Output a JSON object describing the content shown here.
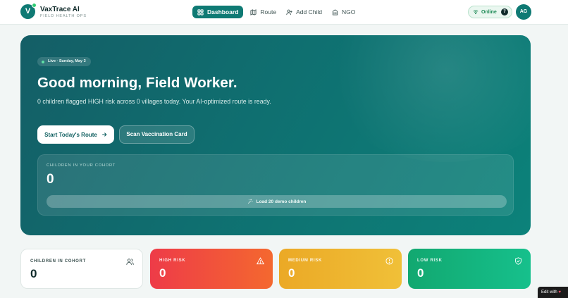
{
  "brand": {
    "logo_letter": "V",
    "name": "VaxTrace AI",
    "subtitle": "FIELD HEALTH OPS"
  },
  "nav": {
    "items": [
      {
        "label": "Dashboard",
        "icon": "grid-icon",
        "active": true
      },
      {
        "label": "Route",
        "icon": "map-icon",
        "active": false
      },
      {
        "label": "Add Child",
        "icon": "user-plus-icon",
        "active": false
      },
      {
        "label": "NGO",
        "icon": "building-icon",
        "active": false
      }
    ]
  },
  "status": {
    "online_label": "Online",
    "online_count": "7",
    "icon": "wifi-icon"
  },
  "user": {
    "initials": "AG"
  },
  "hero": {
    "live_badge": "Live · Sunday, May 3",
    "greeting": "Good morning, Field Worker.",
    "summary": "0 children flagged HIGH risk across 0 villages today. Your AI-optimized route is ready.",
    "primary_button": "Start Today's Route",
    "secondary_button": "Scan Vaccination Card",
    "cohort": {
      "label": "CHILDREN IN YOUR COHORT",
      "value": "0",
      "load_button": "Load 20 demo children"
    }
  },
  "stats": [
    {
      "label": "CHILDREN IN COHORT",
      "value": "0",
      "icon": "users-icon"
    },
    {
      "label": "HIGH RISK",
      "value": "0",
      "icon": "alert-triangle-icon"
    },
    {
      "label": "MEDIUM RISK",
      "value": "0",
      "icon": "alert-circle-icon"
    },
    {
      "label": "LOW RISK",
      "value": "0",
      "icon": "shield-check-icon"
    }
  ],
  "edit_badge": "Edit with",
  "colors": {
    "brand_teal": "#0f7a74",
    "high_risk": "#ee3b48",
    "medium_risk": "#eba926",
    "low_risk": "#12a870",
    "online_green": "#1c8a55"
  }
}
